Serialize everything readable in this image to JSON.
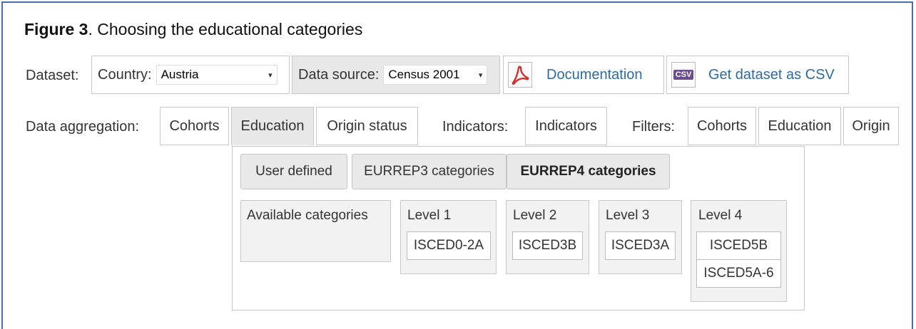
{
  "caption": {
    "figure_label": "Figure 3",
    "text": ". Choosing the educational categories"
  },
  "dataset_row": {
    "label": "Dataset:",
    "country_label": "Country:",
    "country_value": "Austria",
    "source_label": "Data source:",
    "source_value": "Census 2001",
    "documentation": "Documentation",
    "get_csv": "Get dataset as CSV",
    "csv_icon_text": "CSV"
  },
  "aggregation_row": {
    "label": "Data aggregation:",
    "items": [
      "Cohorts",
      "Education",
      "Origin status"
    ],
    "indicators_label": "Indicators:",
    "indicators_button": "Indicators",
    "filters_label": "Filters:",
    "filters": [
      "Cohorts",
      "Education",
      "Origin"
    ]
  },
  "education_panel": {
    "tabs": [
      "User defined",
      "EURREP3 categories",
      "EURREP4 categories"
    ],
    "active_tab": "EURREP4 categories",
    "available_label": "Available categories",
    "levels": [
      {
        "label": "Level 1",
        "items": [
          "ISCED0-2A"
        ]
      },
      {
        "label": "Level 2",
        "items": [
          "ISCED3B"
        ]
      },
      {
        "label": "Level 3",
        "items": [
          "ISCED3A"
        ]
      },
      {
        "label": "Level 4",
        "items": [
          "ISCED5B",
          "ISCED5A-6"
        ]
      }
    ]
  },
  "colors": {
    "frame": "#4a6fa5",
    "link": "#2f6aa3",
    "pdf_red": "#d32f2f",
    "csv_purple": "#6b4c8c"
  }
}
